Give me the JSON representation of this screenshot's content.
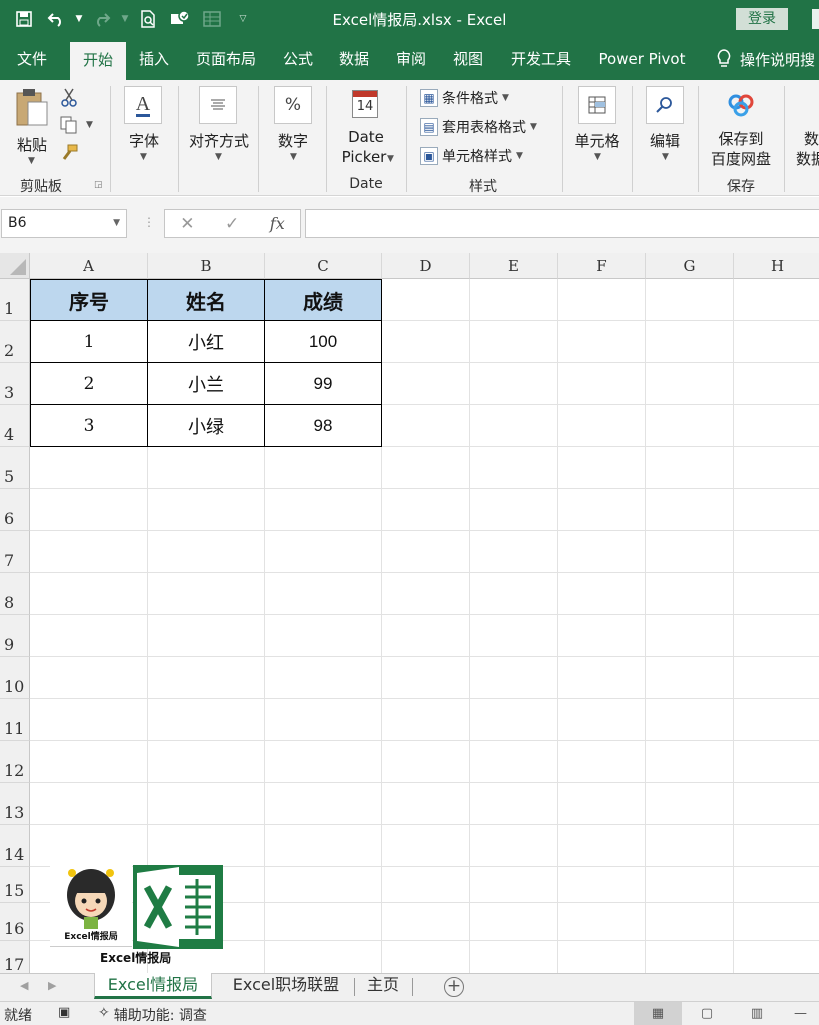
{
  "window": {
    "title": "Excel情报局.xlsx  -  Excel",
    "login_label": "登录"
  },
  "qat": {
    "icons": [
      "save-icon",
      "undo-icon",
      "redo-icon",
      "print-preview-icon",
      "touch-mode-icon",
      "form-icon",
      "customize-icon"
    ]
  },
  "tabs": [
    {
      "label": "文件"
    },
    {
      "label": "开始"
    },
    {
      "label": "插入"
    },
    {
      "label": "页面布局"
    },
    {
      "label": "公式"
    },
    {
      "label": "数据"
    },
    {
      "label": "审阅"
    },
    {
      "label": "视图"
    },
    {
      "label": "开发工具"
    },
    {
      "label": "Power Pivot"
    }
  ],
  "active_tab": "开始",
  "tell_me": "操作说明搜",
  "ribbon": {
    "clipboard": {
      "paste": "粘贴",
      "group": "剪贴板"
    },
    "font": {
      "label": "字体",
      "icon_text": "A"
    },
    "align": {
      "label": "对齐方式"
    },
    "number": {
      "label": "数字",
      "icon_text": "%"
    },
    "date": {
      "label1": "Date",
      "label2": "Picker",
      "group": "Date",
      "icon_text": "14"
    },
    "styles": {
      "conditional": "条件格式",
      "table_format": "套用表格格式",
      "cell_style": "单元格样式",
      "group": "样式"
    },
    "cells": {
      "label": "单元格"
    },
    "edit": {
      "label": "编辑"
    },
    "save": {
      "label1": "保存到",
      "label2": "百度网盘",
      "group": "保存"
    },
    "more": {
      "label1": "数",
      "label2": "数据"
    }
  },
  "formula_bar": {
    "name_box": "B6",
    "fx": "fx",
    "formula": ""
  },
  "grid": {
    "columns": [
      "A",
      "B",
      "C",
      "D",
      "E",
      "F",
      "G",
      "H"
    ],
    "rows": [
      "1",
      "2",
      "3",
      "4",
      "5",
      "6",
      "7",
      "8",
      "9",
      "10",
      "11",
      "12",
      "13",
      "14",
      "15",
      "16",
      "17"
    ]
  },
  "table": {
    "headers": [
      "序号",
      "姓名",
      "成绩"
    ],
    "rows": [
      [
        "1",
        "小红",
        "100"
      ],
      [
        "2",
        "小兰",
        "99"
      ],
      [
        "3",
        "小绿",
        "98"
      ]
    ]
  },
  "logo": {
    "caption": "Excel情报局",
    "small_caption": "Excel情报局"
  },
  "sheets": [
    {
      "label": "Excel情报局",
      "active": true
    },
    {
      "label": "Excel职场联盟",
      "active": false
    },
    {
      "label": "主页",
      "active": false
    }
  ],
  "status": {
    "ready": "就绪",
    "accessibility": "辅助功能: 调查"
  },
  "colors": {
    "excel_green": "#217346",
    "header_fill": "#bdd7ee"
  }
}
